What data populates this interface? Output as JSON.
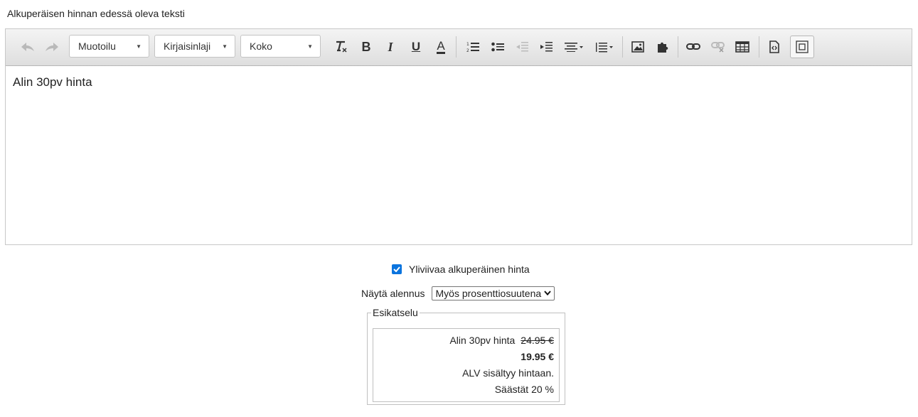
{
  "field_label": "Alkuperäisen hinnan edessä oleva teksti",
  "toolbar": {
    "undo_icon": "undo-icon",
    "redo_icon": "redo-icon",
    "format_label": "Muotoilu",
    "font_label": "Kirjaisinlaji",
    "size_label": "Koko",
    "buttons": [
      "remove-format-icon",
      "bold-icon",
      "italic-icon",
      "underline-icon",
      "text-color-icon",
      "numbered-list-icon",
      "bullet-list-icon",
      "outdent-icon",
      "indent-icon",
      "align-icon",
      "line-height-icon",
      "image-icon",
      "plugin-icon",
      "link-icon",
      "unlink-icon",
      "table-icon",
      "source-icon",
      "fullscreen-icon"
    ],
    "bold_glyph": "B",
    "italic_glyph": "I",
    "underline_glyph": "U",
    "text_color_glyph": "A"
  },
  "editor": {
    "content": "Alin 30pv hinta"
  },
  "options": {
    "strikethrough_label": "Yliviivaa alkuperäinen hinta",
    "strikethrough_checked": true,
    "discount_label": "Näytä alennus",
    "discount_value": "Myös prosenttiosuutena"
  },
  "preview": {
    "legend": "Esikatselu",
    "original_text": "Alin 30pv hinta",
    "original_price": "24.95 €",
    "new_price": "19.95 €",
    "vat_text": "ALV sisältyy hintaan.",
    "savings_text": "Säästät 20 %"
  },
  "colors": {
    "accent": "#0b74de",
    "toolbar_top": "#f4f4f4",
    "toolbar_bottom": "#dedede"
  }
}
